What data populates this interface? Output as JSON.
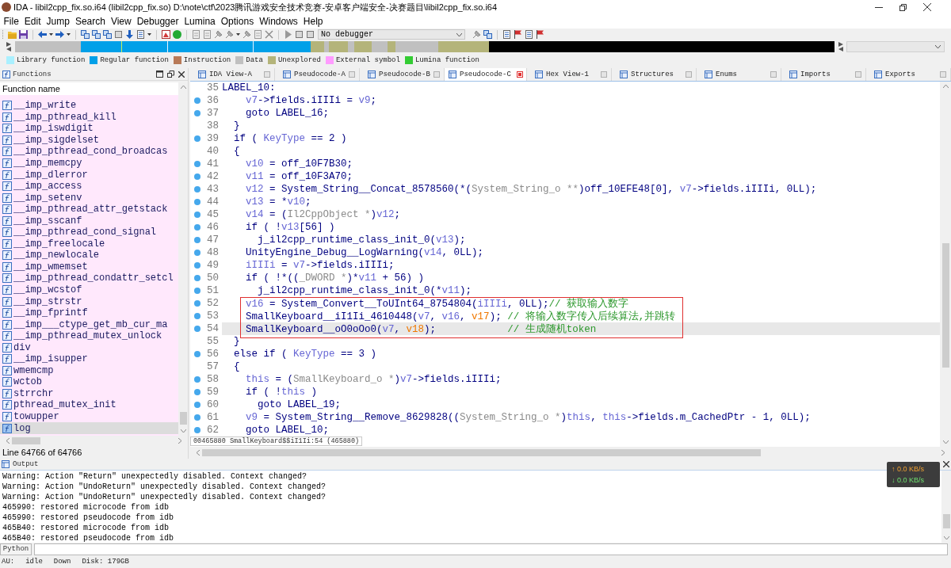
{
  "window": {
    "title": "IDA - libil2cpp_fix.so.i64 (libil2cpp_fix.so) D:\\note\\ctf\\2023腾讯游戏安全技术竞赛-安卓客户端安全-决赛题目\\libil2cpp_fix.so.i64"
  },
  "menu": [
    "File",
    "Edit",
    "Jump",
    "Search",
    "View",
    "Debugger",
    "Lumina",
    "Options",
    "Windows",
    "Help"
  ],
  "toolbar": {
    "debugger_select": "No debugger"
  },
  "legend": [
    {
      "label": "Library function",
      "color": "#aaf0ff"
    },
    {
      "label": "Regular function",
      "color": "#00a0e8"
    },
    {
      "label": "Instruction",
      "color": "#b87a58"
    },
    {
      "label": "Data",
      "color": "#c0c0c0"
    },
    {
      "label": "Unexplored",
      "color": "#b4b47a"
    },
    {
      "label": "External symbol",
      "color": "#ff9cff"
    },
    {
      "label": "Lumina function",
      "color": "#33cc33"
    }
  ],
  "functions_panel": {
    "title": "Functions",
    "column": "Function name",
    "items": [
      {
        "name": "__imp_write",
        "selected": false
      },
      {
        "name": "__imp_pthread_kill",
        "selected": false
      },
      {
        "name": "__imp_iswdigit",
        "selected": false
      },
      {
        "name": "__imp_sigdelset",
        "selected": false
      },
      {
        "name": "__imp_pthread_cond_broadcas",
        "selected": false
      },
      {
        "name": "__imp_memcpy",
        "selected": false
      },
      {
        "name": "__imp_dlerror",
        "selected": false
      },
      {
        "name": "__imp_access",
        "selected": false
      },
      {
        "name": "__imp_setenv",
        "selected": false
      },
      {
        "name": "__imp_pthread_attr_getstack",
        "selected": false
      },
      {
        "name": "__imp_sscanf",
        "selected": false
      },
      {
        "name": "__imp_pthread_cond_signal",
        "selected": false
      },
      {
        "name": "__imp_freelocale",
        "selected": false
      },
      {
        "name": "__imp_newlocale",
        "selected": false
      },
      {
        "name": "__imp_wmemset",
        "selected": false
      },
      {
        "name": "__imp_pthread_condattr_setcl",
        "selected": false
      },
      {
        "name": "__imp_wcstof",
        "selected": false
      },
      {
        "name": "__imp_strstr",
        "selected": false
      },
      {
        "name": "__imp_fprintf",
        "selected": false
      },
      {
        "name": "__imp___ctype_get_mb_cur_ma",
        "selected": false
      },
      {
        "name": "__imp_pthread_mutex_unlock",
        "selected": false
      },
      {
        "name": "div",
        "selected": false
      },
      {
        "name": "__imp_isupper",
        "selected": false
      },
      {
        "name": "wmemcmp",
        "selected": false
      },
      {
        "name": "wctob",
        "selected": false
      },
      {
        "name": "strrchr",
        "selected": false
      },
      {
        "name": "pthread_mutex_init",
        "selected": false
      },
      {
        "name": "towupper",
        "selected": false
      },
      {
        "name": "log",
        "selected": true
      }
    ],
    "status": "Line 64766 of 64766"
  },
  "tabs": [
    {
      "label": "IDA View-A",
      "selected": false
    },
    {
      "label": "Pseudocode-A",
      "selected": false
    },
    {
      "label": "Pseudocode-B",
      "selected": false
    },
    {
      "label": "Pseudocode-C",
      "selected": true
    },
    {
      "label": "Hex View-1",
      "selected": false
    },
    {
      "label": "Structures",
      "selected": false
    },
    {
      "label": "Enums",
      "selected": false
    },
    {
      "label": "Imports",
      "selected": false
    },
    {
      "label": "Exports",
      "selected": false
    }
  ],
  "pseudocode": {
    "lines": [
      {
        "number": "35",
        "marked": false,
        "selected": false,
        "annotated": false,
        "tokens": [
          {
            "text": "LABEL_10:",
            "kind": "plain"
          }
        ]
      },
      {
        "number": "36",
        "marked": true,
        "selected": false,
        "annotated": false,
        "tokens": [
          {
            "text": "    v7",
            "kind": "local"
          },
          {
            "text": "->fields.iIIIi = ",
            "kind": "plain"
          },
          {
            "text": "v9",
            "kind": "local"
          },
          {
            "text": ";",
            "kind": "plain"
          }
        ]
      },
      {
        "number": "37",
        "marked": true,
        "selected": false,
        "annotated": false,
        "tokens": [
          {
            "text": "    goto LABEL_16;",
            "kind": "plain"
          }
        ]
      },
      {
        "number": "38",
        "marked": false,
        "selected": false,
        "annotated": false,
        "tokens": [
          {
            "text": "  }",
            "kind": "plain"
          }
        ]
      },
      {
        "number": "39",
        "marked": true,
        "selected": false,
        "annotated": false,
        "tokens": [
          {
            "text": "  if ( ",
            "kind": "plain"
          },
          {
            "text": "KeyType",
            "kind": "local"
          },
          {
            "text": " == 2 )",
            "kind": "plain"
          }
        ]
      },
      {
        "number": "40",
        "marked": false,
        "selected": false,
        "annotated": false,
        "tokens": [
          {
            "text": "  {",
            "kind": "plain"
          }
        ]
      },
      {
        "number": "41",
        "marked": true,
        "selected": false,
        "annotated": false,
        "tokens": [
          {
            "text": "    v10",
            "kind": "local"
          },
          {
            "text": " = off_10F7B30;",
            "kind": "plain"
          }
        ]
      },
      {
        "number": "42",
        "marked": true,
        "selected": false,
        "annotated": false,
        "tokens": [
          {
            "text": "    v11",
            "kind": "local"
          },
          {
            "text": " = off_10F3A70;",
            "kind": "plain"
          }
        ]
      },
      {
        "number": "43",
        "marked": true,
        "selected": false,
        "annotated": false,
        "tokens": [
          {
            "text": "    v12",
            "kind": "local"
          },
          {
            "text": " = System_String__Concat_8578560(*(",
            "kind": "plain"
          },
          {
            "text": "System_String_o **",
            "kind": "type"
          },
          {
            "text": ")off_10EFE48[0], ",
            "kind": "plain"
          },
          {
            "text": "v7",
            "kind": "local"
          },
          {
            "text": "->fields.iIIIi, 0LL);",
            "kind": "plain"
          }
        ]
      },
      {
        "number": "44",
        "marked": true,
        "selected": false,
        "annotated": false,
        "tokens": [
          {
            "text": "    v13",
            "kind": "local"
          },
          {
            "text": " = *",
            "kind": "plain"
          },
          {
            "text": "v10",
            "kind": "local"
          },
          {
            "text": ";",
            "kind": "plain"
          }
        ]
      },
      {
        "number": "45",
        "marked": true,
        "selected": false,
        "annotated": false,
        "tokens": [
          {
            "text": "    v14",
            "kind": "local"
          },
          {
            "text": " = (",
            "kind": "plain"
          },
          {
            "text": "Il2CppObject *",
            "kind": "type"
          },
          {
            "text": ")",
            "kind": "plain"
          },
          {
            "text": "v12",
            "kind": "local"
          },
          {
            "text": ";",
            "kind": "plain"
          }
        ]
      },
      {
        "number": "46",
        "marked": true,
        "selected": false,
        "annotated": false,
        "tokens": [
          {
            "text": "    if ( !",
            "kind": "plain"
          },
          {
            "text": "v13",
            "kind": "local"
          },
          {
            "text": "[56] )",
            "kind": "plain"
          }
        ]
      },
      {
        "number": "47",
        "marked": true,
        "selected": false,
        "annotated": false,
        "tokens": [
          {
            "text": "      j_il2cpp_runtime_class_init_0(",
            "kind": "plain"
          },
          {
            "text": "v13",
            "kind": "local"
          },
          {
            "text": ");",
            "kind": "plain"
          }
        ]
      },
      {
        "number": "48",
        "marked": true,
        "selected": false,
        "annotated": false,
        "tokens": [
          {
            "text": "    UnityEngine_Debug__LogWarning(",
            "kind": "plain"
          },
          {
            "text": "v14",
            "kind": "local"
          },
          {
            "text": ", 0LL);",
            "kind": "plain"
          }
        ]
      },
      {
        "number": "49",
        "marked": true,
        "selected": false,
        "annotated": false,
        "tokens": [
          {
            "text": "    iIIIi",
            "kind": "local"
          },
          {
            "text": " = ",
            "kind": "plain"
          },
          {
            "text": "v7",
            "kind": "local"
          },
          {
            "text": "->fields.iIIIi;",
            "kind": "plain"
          }
        ]
      },
      {
        "number": "50",
        "marked": true,
        "selected": false,
        "annotated": false,
        "tokens": [
          {
            "text": "    if ( !*((",
            "kind": "plain"
          },
          {
            "text": "_DWORD *",
            "kind": "type"
          },
          {
            "text": ")*",
            "kind": "plain"
          },
          {
            "text": "v11",
            "kind": "local"
          },
          {
            "text": " + 56) )",
            "kind": "plain"
          }
        ]
      },
      {
        "number": "51",
        "marked": true,
        "selected": false,
        "annotated": false,
        "tokens": [
          {
            "text": "      j_il2cpp_runtime_class_init_0(*",
            "kind": "plain"
          },
          {
            "text": "v11",
            "kind": "local"
          },
          {
            "text": ");",
            "kind": "plain"
          }
        ]
      },
      {
        "number": "52",
        "marked": true,
        "selected": false,
        "annotated": true,
        "tokens": [
          {
            "text": "    v16",
            "kind": "local"
          },
          {
            "text": " = System_Convert__ToUInt64_8754804(",
            "kind": "plain"
          },
          {
            "text": "iIIIi",
            "kind": "local"
          },
          {
            "text": ", 0LL);",
            "kind": "plain"
          },
          {
            "text": "// 获取输入数字",
            "kind": "comment"
          }
        ]
      },
      {
        "number": "53",
        "marked": true,
        "selected": false,
        "annotated": true,
        "tokens": [
          {
            "text": "    SmallKeyboard__iI1Ii_4610448(",
            "kind": "plain"
          },
          {
            "text": "v7",
            "kind": "local"
          },
          {
            "text": ", ",
            "kind": "plain"
          },
          {
            "text": "v16",
            "kind": "local"
          },
          {
            "text": ", ",
            "kind": "plain"
          },
          {
            "text": "v17",
            "kind": "undefined"
          },
          {
            "text": "); ",
            "kind": "plain"
          },
          {
            "text": "// 将输入数字传入后续算法,并跳转",
            "kind": "comment"
          }
        ]
      },
      {
        "number": "54",
        "marked": true,
        "selected": true,
        "annotated": true,
        "tokens": [
          {
            "text": "    SmallKeyboard__oO0oOo0(",
            "kind": "plain"
          },
          {
            "text": "v7",
            "kind": "local"
          },
          {
            "text": ", ",
            "kind": "plain"
          },
          {
            "text": "v18",
            "kind": "undefined"
          },
          {
            "text": ");            ",
            "kind": "plain"
          },
          {
            "text": "// 生成随机token",
            "kind": "comment"
          }
        ]
      },
      {
        "number": "55",
        "marked": false,
        "selected": false,
        "annotated": false,
        "tokens": [
          {
            "text": "  }",
            "kind": "plain"
          }
        ]
      },
      {
        "number": "56",
        "marked": true,
        "selected": false,
        "annotated": false,
        "tokens": [
          {
            "text": "  else if ( ",
            "kind": "plain"
          },
          {
            "text": "KeyType",
            "kind": "local"
          },
          {
            "text": " == 3 )",
            "kind": "plain"
          }
        ]
      },
      {
        "number": "57",
        "marked": false,
        "selected": false,
        "annotated": false,
        "tokens": [
          {
            "text": "  {",
            "kind": "plain"
          }
        ]
      },
      {
        "number": "58",
        "marked": true,
        "selected": false,
        "annotated": false,
        "tokens": [
          {
            "text": "    this",
            "kind": "local"
          },
          {
            "text": " = (",
            "kind": "plain"
          },
          {
            "text": "SmallKeyboard_o *",
            "kind": "type"
          },
          {
            "text": ")",
            "kind": "plain"
          },
          {
            "text": "v7",
            "kind": "local"
          },
          {
            "text": "->fields.iIIIi;",
            "kind": "plain"
          }
        ]
      },
      {
        "number": "59",
        "marked": true,
        "selected": false,
        "annotated": false,
        "tokens": [
          {
            "text": "    if ( !",
            "kind": "plain"
          },
          {
            "text": "this",
            "kind": "local"
          },
          {
            "text": " )",
            "kind": "plain"
          }
        ]
      },
      {
        "number": "60",
        "marked": true,
        "selected": false,
        "annotated": false,
        "tokens": [
          {
            "text": "      goto LABEL_19;",
            "kind": "plain"
          }
        ]
      },
      {
        "number": "61",
        "marked": true,
        "selected": false,
        "annotated": false,
        "tokens": [
          {
            "text": "    v9",
            "kind": "local"
          },
          {
            "text": " = System_String__Remove_8629828((",
            "kind": "plain"
          },
          {
            "text": "System_String_o *",
            "kind": "type"
          },
          {
            "text": ")",
            "kind": "plain"
          },
          {
            "text": "this",
            "kind": "local"
          },
          {
            "text": ", ",
            "kind": "plain"
          },
          {
            "text": "this",
            "kind": "local"
          },
          {
            "text": "->fields.m_CachedPtr - 1, 0LL);",
            "kind": "plain"
          }
        ]
      },
      {
        "number": "62",
        "marked": true,
        "selected": false,
        "annotated": false,
        "tokens": [
          {
            "text": "    goto LABEL_10;",
            "kind": "plain"
          }
        ]
      }
    ],
    "status": "00465880 SmallKeyboard$$iI1Ii:54 (465880)"
  },
  "output": {
    "title": "Output",
    "lines": [
      "Warning: Action \"Return\" unexpectedly disabled. Context changed?",
      "Warning: Action \"UndoReturn\" unexpectedly disabled. Context changed?",
      "Warning: Action \"UndoReturn\" unexpectedly disabled. Context changed?",
      "465990: restored microcode from idb",
      "465990: restored pseudocode from idb",
      "465B40: restored microcode from idb",
      "465B40: restored pseudocode from idb"
    ]
  },
  "net_monitor": {
    "upload": "↑ 0.0 KB/s",
    "download": "↓ 0.0 KB/s"
  },
  "python": {
    "label": "Python"
  },
  "status_bar": [
    "AU:",
    "idle",
    "Down",
    "Disk: 179GB"
  ]
}
